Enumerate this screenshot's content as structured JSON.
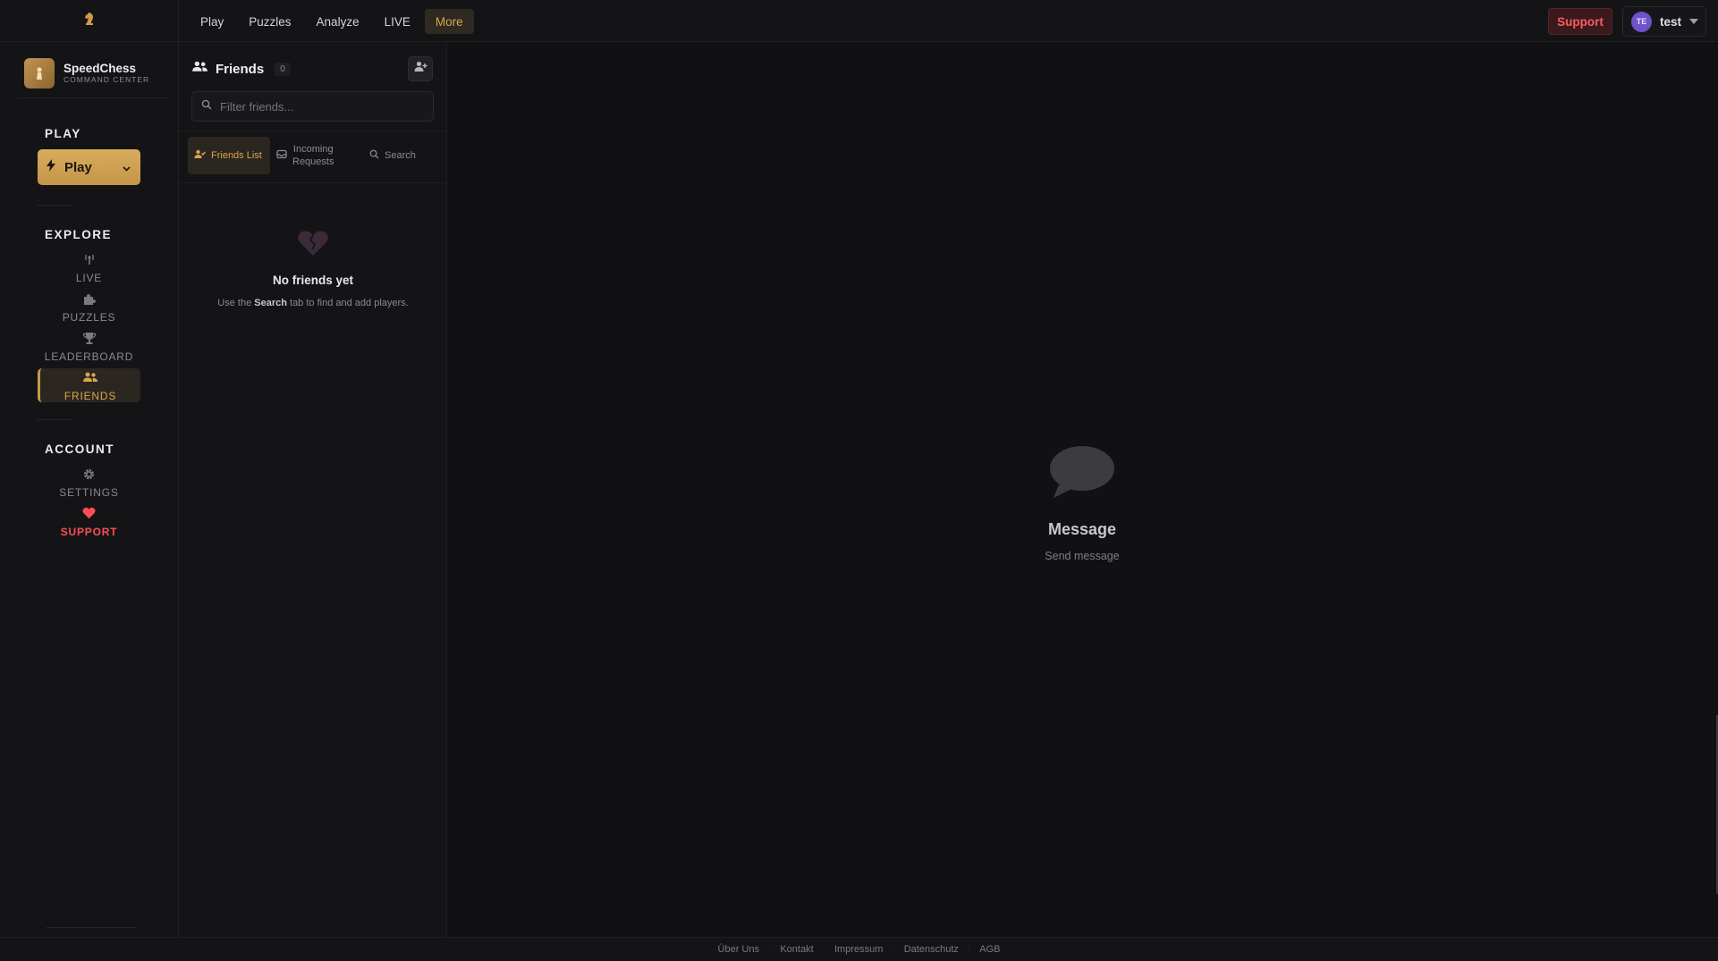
{
  "topbar": {
    "nav": [
      "Play",
      "Puzzles",
      "Analyze",
      "LIVE",
      "More"
    ],
    "active_nav": "More",
    "support_label": "Support",
    "user": {
      "initials": "TE",
      "name": "test"
    }
  },
  "brand": {
    "name": "SpeedChess",
    "subtitle": "COMMAND CENTER"
  },
  "sidebar": {
    "play_title": "PLAY",
    "play_button": "Play",
    "explore_title": "EXPLORE",
    "explore_items": [
      {
        "label": "LIVE",
        "icon": "broadcast-icon"
      },
      {
        "label": "PUZZLES",
        "icon": "puzzle-icon"
      },
      {
        "label": "LEADERBOARD",
        "icon": "trophy-icon"
      },
      {
        "label": "FRIENDS",
        "icon": "users-icon",
        "active": true
      }
    ],
    "account_title": "ACCOUNT",
    "account_items": [
      {
        "label": "SETTINGS",
        "icon": "gear-icon"
      },
      {
        "label": "SUPPORT",
        "icon": "heart-icon"
      }
    ]
  },
  "friends": {
    "title": "Friends",
    "count": "0",
    "filter_placeholder": "Filter friends...",
    "tabs": {
      "friends_list": "Friends List",
      "incoming_line1": "Incoming",
      "incoming_line2": "Requests",
      "search": "Search"
    },
    "empty": {
      "title": "No friends yet",
      "desc_pre": "Use the ",
      "desc_bold": "Search",
      "desc_post": " tab to find and add players."
    }
  },
  "main": {
    "message_title": "Message",
    "message_sub": "Send message"
  },
  "footer": {
    "links": [
      "Über Uns",
      "Kontakt",
      "Impressum",
      "Datenschutz",
      "AGB"
    ]
  },
  "colors": {
    "accent": "#d9a54e",
    "support": "#ff4d55",
    "avatar": "#6e52c9",
    "background": "#111113"
  }
}
